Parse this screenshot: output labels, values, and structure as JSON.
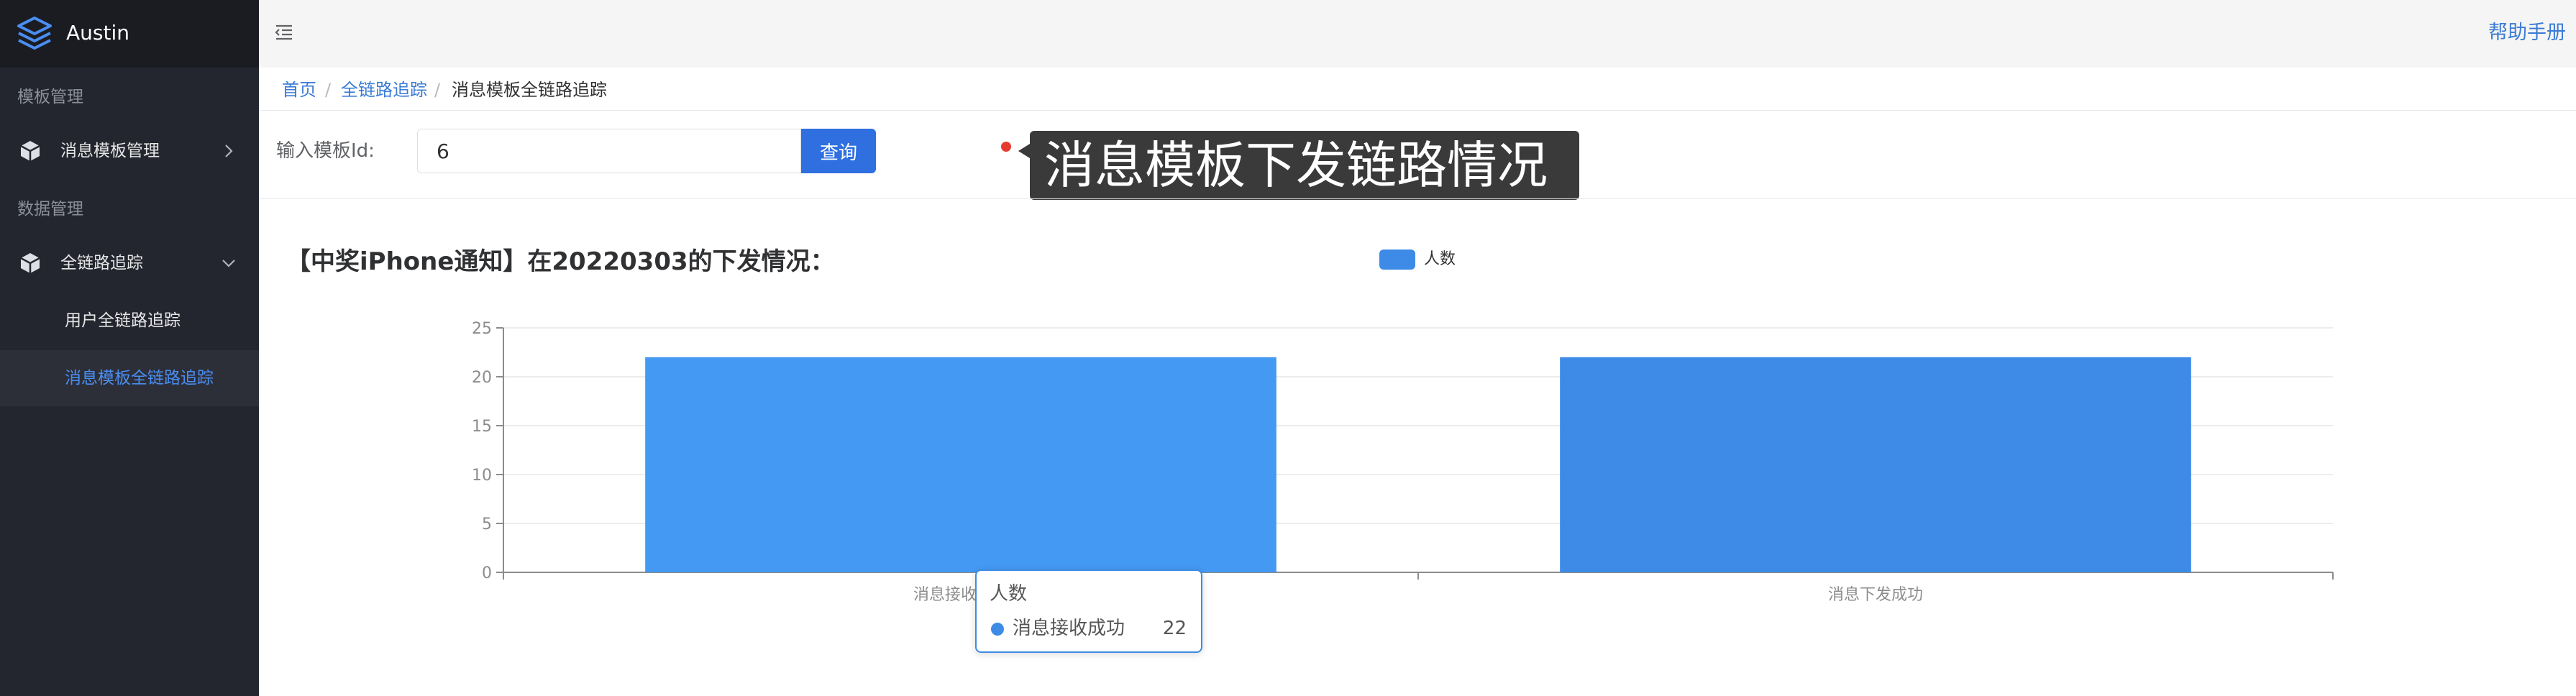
{
  "brand": {
    "name": "Austin",
    "logo_icon": "stacked-layers-icon"
  },
  "sidebar": {
    "groups": [
      {
        "title": "模板管理"
      },
      {
        "title": "数据管理"
      }
    ],
    "items": [
      {
        "label": "消息模板管理",
        "icon": "cube-icon",
        "arrow": "chevron-right-icon"
      },
      {
        "label": "全链路追踪",
        "icon": "cube-icon",
        "arrow": "chevron-down-icon"
      }
    ],
    "sub_items": [
      {
        "label": "用户全链路追踪"
      },
      {
        "label": "消息模板全链路追踪"
      }
    ]
  },
  "header": {
    "help_label": "帮助手册",
    "toggle_icon": "menu-fold-icon"
  },
  "breadcrumb": {
    "items": [
      "首页",
      "全链路追踪",
      "消息模板全链路追踪"
    ],
    "separator": "/"
  },
  "query": {
    "label": "输入模板Id:",
    "value": "6",
    "button_label": "查询"
  },
  "tip": {
    "text": "消息模板下发链路情况"
  },
  "colors": {
    "accent": "#3a7bd5",
    "bar": "#3d8be6",
    "bar_highlight": "#4499f2",
    "sidebar_bg": "#24262f"
  },
  "chart_data": {
    "type": "bar",
    "title": "【中奖iPhone通知】在20220303的下发情况：",
    "categories": [
      "消息接收成功",
      "消息下发成功"
    ],
    "series": [
      {
        "name": "人数",
        "values": [
          22,
          22
        ]
      }
    ],
    "ylim": [
      0,
      25
    ],
    "yticks": [
      0,
      5,
      10,
      15,
      20,
      25
    ],
    "grid": true,
    "legend": "top-center"
  },
  "tooltip": {
    "title": "人数",
    "name": "消息接收成功",
    "value": "22"
  }
}
